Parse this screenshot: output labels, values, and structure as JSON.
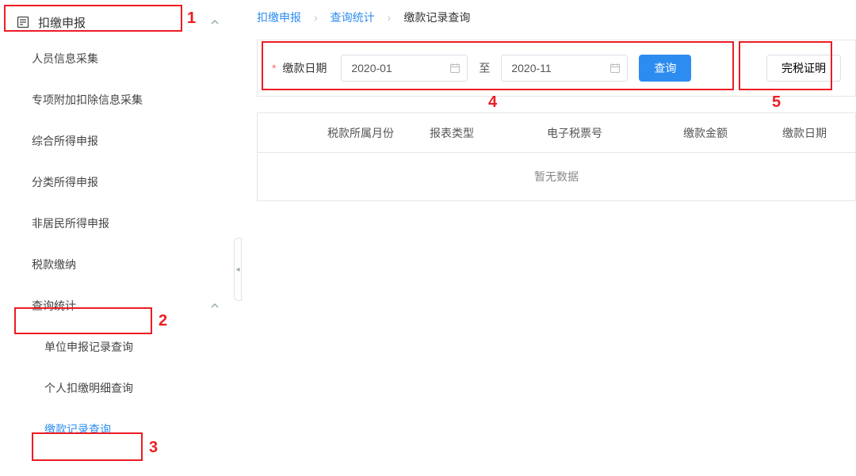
{
  "sidebar": {
    "top_section": {
      "label": "扣缴申报",
      "icon": "form-icon"
    },
    "items": [
      {
        "label": "人员信息采集"
      },
      {
        "label": "专项附加扣除信息采集"
      },
      {
        "label": "综合所得申报"
      },
      {
        "label": "分类所得申报"
      },
      {
        "label": "非居民所得申报"
      },
      {
        "label": "税款缴纳"
      }
    ],
    "query_section": {
      "label": "查询统计"
    },
    "query_items": [
      {
        "label": "单位申报记录查询"
      },
      {
        "label": "个人扣缴明细查询"
      },
      {
        "label": "缴款记录查询",
        "active": true
      }
    ]
  },
  "breadcrumbs": {
    "items": [
      "扣缴申报",
      "查询统计",
      "缴款记录查询"
    ]
  },
  "filter": {
    "date_label": "缴款日期",
    "date_from": "2020-01",
    "to": "至",
    "date_to": "2020-11",
    "query_btn": "查询",
    "cert_btn": "完税证明"
  },
  "table": {
    "headers": [
      "",
      "税款所属月份",
      "报表类型",
      "电子税票号",
      "缴款金额",
      "缴款日期"
    ],
    "rows": [],
    "empty": "暂无数据"
  },
  "annotations": [
    "1",
    "2",
    "3",
    "4",
    "5"
  ]
}
